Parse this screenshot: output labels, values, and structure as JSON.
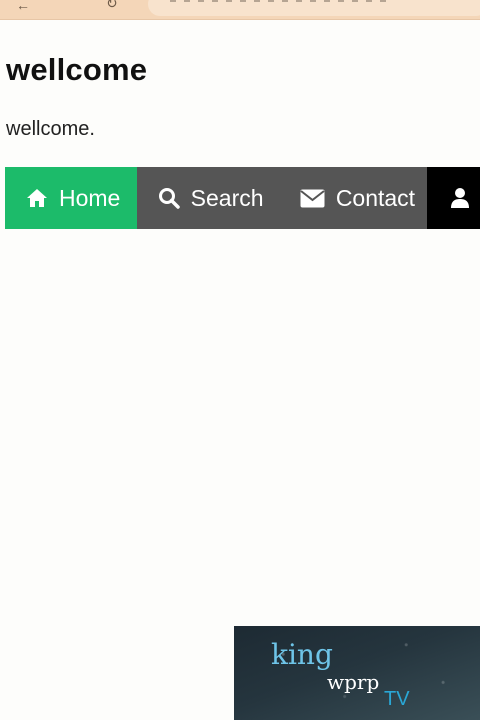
{
  "browser": {
    "back_icon": "arrow-left-icon",
    "reload_icon": "reload-icon"
  },
  "page": {
    "title": "wellcome",
    "text": "wellcome."
  },
  "navbar": {
    "items": [
      {
        "label": "Home",
        "icon": "home-icon",
        "active": true,
        "color": "#1cbb6a"
      },
      {
        "label": "Search",
        "icon": "search-icon",
        "active": false
      },
      {
        "label": "Contact",
        "icon": "envelope-icon",
        "active": false
      },
      {
        "label": "",
        "icon": "user-icon",
        "active": false,
        "color": "#000000"
      }
    ],
    "background": "#555555"
  },
  "watermark": {
    "line1": "king",
    "line2": "wprp",
    "line3": "TV"
  }
}
